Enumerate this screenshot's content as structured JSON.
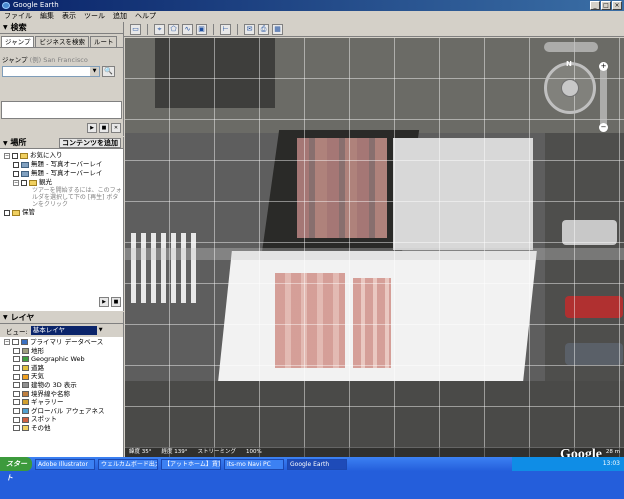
{
  "window": {
    "title": "Google Earth"
  },
  "menu": [
    "ファイル",
    "編集",
    "表示",
    "ツール",
    "追加",
    "ヘルプ"
  ],
  "search": {
    "header": "検索",
    "tabs": [
      "ジャンプ",
      "ビジネスを検索",
      "ルート"
    ],
    "jump_label": "ジャンプ",
    "jump_example": "(例) San Francisco"
  },
  "places": {
    "header": "場所",
    "add_content": "コンテンツを追加",
    "items": [
      "お気に入り",
      "無題 - 写真オーバーレイ",
      "無題 - 写真オーバーレイ",
      "観光",
      "保管"
    ],
    "tour_desc": "ツアーを開始するには、このフォルダを選択して下の [再生] ボタンをクリック"
  },
  "layers": {
    "header": "レイヤ",
    "view_label": "ビュー:",
    "view_value": "基本レイヤ",
    "items": [
      "プライマリ データベース",
      "地形",
      "Geographic Web",
      "道路",
      "天気",
      "建物の 3D 表示",
      "境界線や名称",
      "ギャラリー",
      "グローバル アウェアネス",
      "スポット",
      "その他"
    ]
  },
  "map": {
    "nav_north": "N",
    "logo": "Google",
    "coords_lat": "緯度 35°",
    "coords_lon": "経度 139°",
    "streaming": "ストリーミング",
    "streaming_pct": "100%",
    "altitude": "28 m"
  },
  "taskbar": {
    "start": "スタート",
    "tasks": [
      "Adobe Illustrator",
      "ウェルカムボード出力の作...",
      "【アットホーム】賃貸一戸...",
      "its-mo Navi PC",
      "Google Earth"
    ],
    "clock": "13:03"
  }
}
